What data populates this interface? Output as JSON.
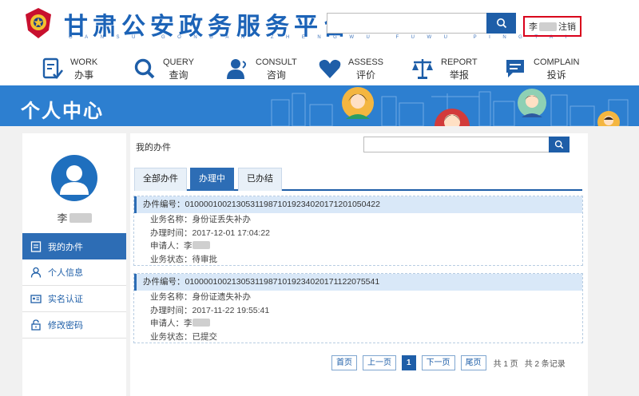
{
  "header": {
    "site_title": "甘肃公安政务服务平台",
    "site_subtitle": "GANSU GONGAN ZHENGWU FUWU PINGTAI",
    "user_name": "李",
    "logout_label": "注销"
  },
  "nav": [
    {
      "en": "WORK",
      "cn": "办事",
      "icon": "work-icon"
    },
    {
      "en": "QUERY",
      "cn": "查询",
      "icon": "query-icon"
    },
    {
      "en": "CONSULT",
      "cn": "咨询",
      "icon": "consult-icon"
    },
    {
      "en": "ASSESS",
      "cn": "评价",
      "icon": "assess-icon"
    },
    {
      "en": "REPORT",
      "cn": "举报",
      "icon": "report-icon"
    },
    {
      "en": "COMPLAIN",
      "cn": "投诉",
      "icon": "complain-icon"
    }
  ],
  "banner": {
    "title": "个人中心"
  },
  "sidebar": {
    "name": "李",
    "items": [
      {
        "label": "我的办件",
        "icon": "document-icon",
        "active": true
      },
      {
        "label": "个人信息",
        "icon": "user-icon"
      },
      {
        "label": "实名认证",
        "icon": "id-card-icon"
      },
      {
        "label": "修改密码",
        "icon": "lock-icon"
      }
    ]
  },
  "main": {
    "title": "我的办件",
    "search_placeholder": "",
    "tabs": [
      {
        "label": "全部办件"
      },
      {
        "label": "办理中",
        "active": true
      },
      {
        "label": "已办结"
      }
    ],
    "records": [
      {
        "id_label": "办件编号：",
        "id": "010000100213053119871019234020171201050422",
        "service_label": "业务名称：",
        "service": "身份证丢失补办",
        "time_label": "办理时间：",
        "time": "2017-12-01 17:04:22",
        "applicant_label": "申请人：",
        "applicant": "李",
        "status_label": "业务状态：",
        "status": "待审批"
      },
      {
        "id_label": "办件编号：",
        "id": "010000100213053119871019234020171122075541",
        "service_label": "业务名称：",
        "service": "身份证遗失补办",
        "time_label": "办理时间：",
        "time": "2017-11-22 19:55:41",
        "applicant_label": "申请人：",
        "applicant": "李",
        "status_label": "业务状态：",
        "status": "已提交"
      }
    ],
    "pager": {
      "first": "首页",
      "prev": "上一页",
      "current": "1",
      "next": "下一页",
      "last": "尾页",
      "page_info": "共 1 页",
      "record_info": "共 2 条记录"
    }
  },
  "colors": {
    "brand_blue": "#1e5ea8",
    "banner_blue": "#2d7fd0",
    "highlight_red": "#d9001b"
  }
}
